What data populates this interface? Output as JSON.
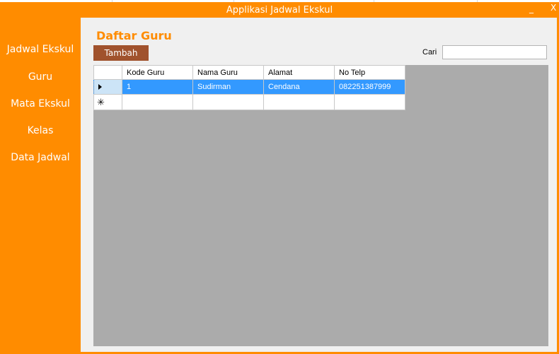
{
  "window": {
    "title": "Applikasi Jadwal Ekskul",
    "minimize_glyph": "_",
    "close_glyph": "X"
  },
  "sidebar": {
    "items": [
      {
        "label": "Jadwal Ekskul"
      },
      {
        "label": "Guru"
      },
      {
        "label": "Mata Ekskul"
      },
      {
        "label": "Kelas"
      },
      {
        "label": "Data Jadwal"
      }
    ]
  },
  "main": {
    "title": "Daftar Guru",
    "add_button_label": "Tambah",
    "search": {
      "label": "Cari",
      "value": ""
    },
    "table": {
      "columns": [
        "Kode Guru",
        "Nama Guru",
        "Alamat",
        "No Telp"
      ],
      "rows": [
        {
          "kode": "1",
          "nama": "Sudirman",
          "alamat": "Cendana",
          "telp": "082251387999"
        }
      ],
      "new_row_glyph": "✳"
    }
  },
  "colors": {
    "accent": "#ff8c00",
    "button": "#a0522d",
    "selection": "#3399ff",
    "grid_background": "#ababab"
  },
  "icons": {
    "row_indicator": "current-row-arrow-icon",
    "new_row": "new-row-star-icon",
    "minimize": "minimize-icon",
    "close": "close-icon"
  }
}
